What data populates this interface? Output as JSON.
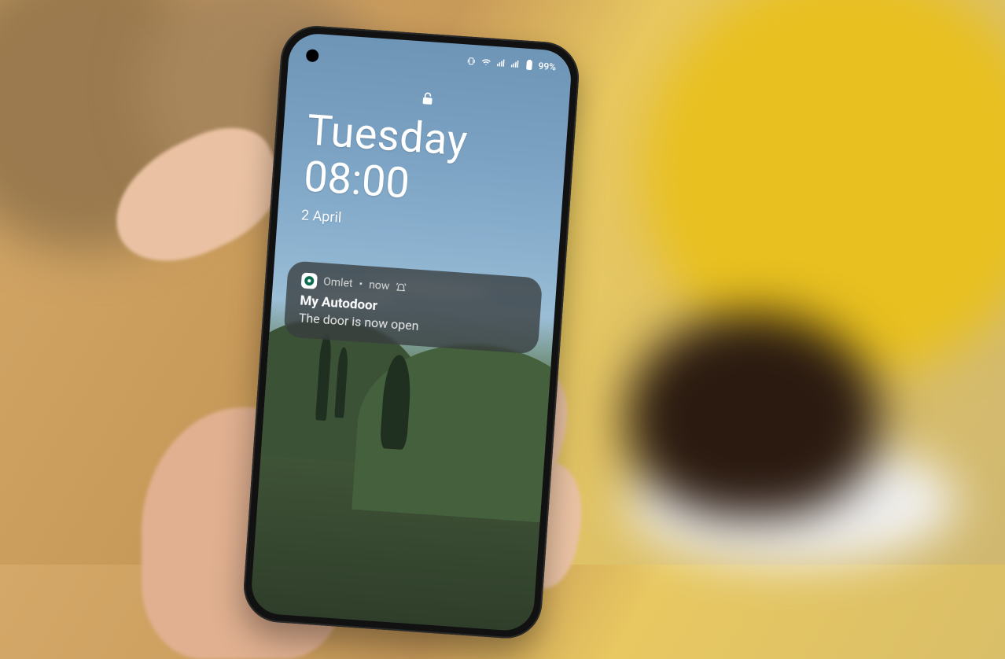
{
  "status_bar": {
    "battery_text": "99%"
  },
  "lockscreen": {
    "day": "Tuesday",
    "time": "08:00",
    "date": "2 April"
  },
  "notification": {
    "app_name": "Omlet",
    "separator": "•",
    "timestamp": "now",
    "title": "My Autodoor",
    "body": "The door is now open"
  }
}
